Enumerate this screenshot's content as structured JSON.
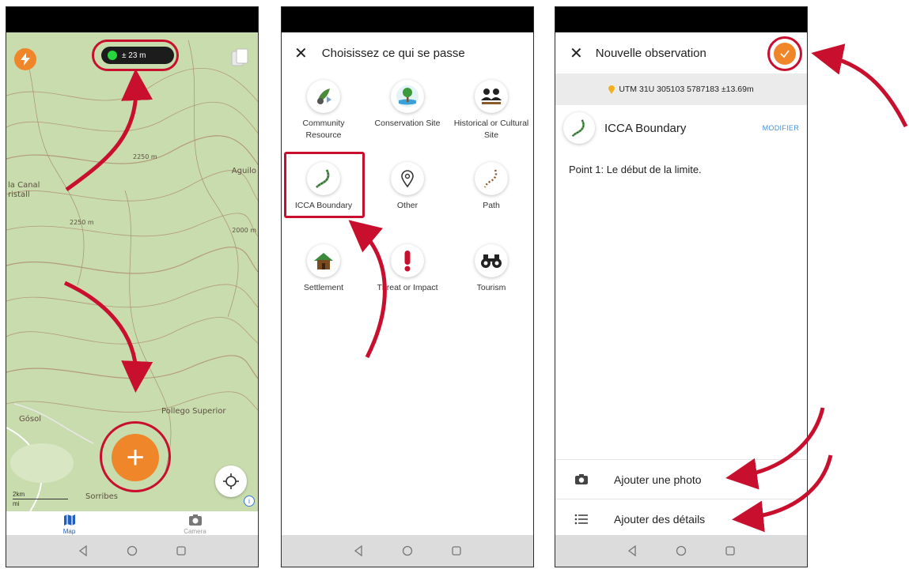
{
  "screen1": {
    "gps_accuracy": "± 23 m",
    "map_labels": {
      "canal": "la Canal",
      "cristall": "ristall",
      "aguilo": "Aguilo",
      "contour_2250a": "2250 m",
      "contour_2250b": "2250 m",
      "contour_2000": "2000 m",
      "gosol": "Gósol",
      "pollego": "Pollego Superior",
      "sorribes": "Sorribes",
      "scale_km": "2km",
      "scale_mi": "mi"
    },
    "add_label": "+",
    "tabs": [
      {
        "label": "Map"
      },
      {
        "label": "Camera"
      }
    ]
  },
  "screen2": {
    "title": "Choisissez ce qui se passe",
    "categories": [
      {
        "label": "Community Resource"
      },
      {
        "label": "Conservation Site"
      },
      {
        "label": "Historical or Cultural Site"
      },
      {
        "label": "ICCA Boundary"
      },
      {
        "label": "Other"
      },
      {
        "label": "Path"
      },
      {
        "label": "Settlement"
      },
      {
        "label": "Threat or Impact"
      },
      {
        "label": "Tourism"
      }
    ]
  },
  "screen3": {
    "title": "Nouvelle observation",
    "coordinates": "UTM 31U 305103 5787183 ±13.69m",
    "category": "ICCA Boundary",
    "modify_label": "MODIFIER",
    "notes": "Point 1: Le début de la limite.",
    "add_photo": "Ajouter une photo",
    "add_details": "Ajouter des détails"
  },
  "colors": {
    "accent": "#f0862a",
    "highlight": "#c8102e",
    "map": "#c9dcae",
    "link": "#4a90d9"
  }
}
